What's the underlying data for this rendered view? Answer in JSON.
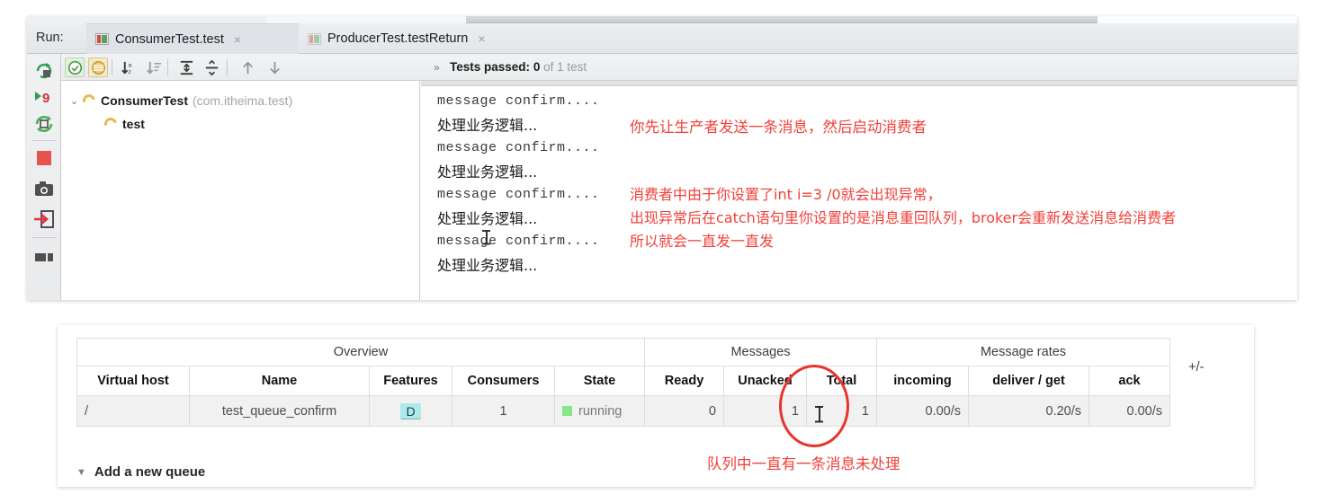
{
  "ide": {
    "run_label": "Run:",
    "tabs": [
      {
        "label": "ConsumerTest.test",
        "close": "×",
        "icon": "run-config-icon",
        "active": true
      },
      {
        "label": "ProducerTest.testReturn",
        "close": "×",
        "icon": "run-config-icon",
        "active": false
      }
    ],
    "left_toolbar": [
      "rerun-icon",
      "rerun-failed-tests-icon",
      "toggle-auto-test-icon",
      "stop-icon",
      "dump-threads-icon",
      "export-to-console-icon",
      "layout-icon"
    ],
    "tests_toolbar": [
      "show-passed-icon",
      "show-ignored-icon",
      "sort-alphabetically-icon",
      "sort-by-duration-icon",
      "expand-all-icon",
      "collapse-all-icon",
      "previous-failed-icon",
      "next-failed-icon"
    ],
    "overflow_chevron": "»",
    "status": {
      "label": "Tests passed:",
      "count": "0",
      "rest": "of 1 test"
    },
    "tree": {
      "caret": "⌄",
      "root_name": "ConsumerTest",
      "root_package": "(com.itheima.test)",
      "child_name": "test"
    },
    "console_lines": [
      {
        "text": "message confirm....",
        "type": "mono"
      },
      {
        "text": "处理业务逻辑...",
        "type": "cjk"
      },
      {
        "text": "message confirm....",
        "type": "mono"
      },
      {
        "text": "处理业务逻辑...",
        "type": "cjk"
      },
      {
        "text": "message confirm....",
        "type": "mono"
      },
      {
        "text": "处理业务逻辑...",
        "type": "cjk"
      },
      {
        "text": "message confirm....",
        "type": "mono"
      },
      {
        "text": "处理业务逻辑...",
        "type": "cjk"
      }
    ]
  },
  "annotations": {
    "color": "#f0403a",
    "note1": "你先让生产者发送一条消息，然后启动消费者",
    "note2_line1": "消费者中由于你设置了int i=3 /0就会出现异常，",
    "note2_line2": "出现异常后在catch语句里你设置的是消息重回队列，broker会重新发送消息给消费者",
    "note2_line3": "所以就会一直发一直发",
    "note3": "队列中一直有一条消息未处理"
  },
  "queues_table": {
    "group_headers": [
      "Overview",
      "Messages",
      "Message rates"
    ],
    "plus_minus": "+/-",
    "columns": [
      "Virtual host",
      "Name",
      "Features",
      "Consumers",
      "State",
      "Ready",
      "Unacked",
      "Total",
      "incoming",
      "deliver / get",
      "ack"
    ],
    "rows": [
      {
        "virtual_host": "/",
        "name": "test_queue_confirm",
        "features": "D",
        "consumers": "1",
        "state": "running",
        "ready": "0",
        "unacked": "1",
        "total": "1",
        "incoming": "0.00/s",
        "deliver_get": "0.20/s",
        "ack": "0.00/s"
      }
    ],
    "state_color": "#87e68a",
    "feature_badge_color": "#aeeaea"
  },
  "add_queue": {
    "triangle": "▼",
    "label": "Add a new queue"
  }
}
